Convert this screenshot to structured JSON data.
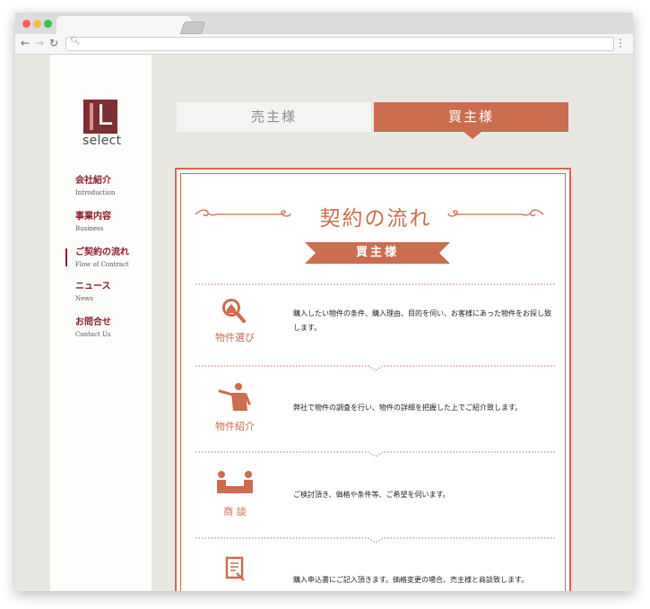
{
  "sidebar": {
    "logo": {
      "letter": "L",
      "wordmark": "select"
    },
    "items": [
      {
        "jp": "会社紹介",
        "en": "Introduction"
      },
      {
        "jp": "事業内容",
        "en": "Business"
      },
      {
        "jp": "ご契約の流れ",
        "en": "Flow of Contract"
      },
      {
        "jp": "ニュース",
        "en": "News"
      },
      {
        "jp": "お問合せ",
        "en": "Contact Us"
      }
    ]
  },
  "tabs": {
    "seller": "売主様",
    "buyer": "買主様"
  },
  "section": {
    "title": "契約の流れ",
    "ribbon": "買主様",
    "steps": [
      {
        "label": "物件選び",
        "desc": "購入したい物件の条件、購入理由、目的を伺い、お客様にあった物件をお探し致します。"
      },
      {
        "label": "物件紹介",
        "desc": "弊社で物件の調査を行い、物件の詳細を把握した上でご紹介致します。"
      },
      {
        "label": "商 談",
        "desc": "ご検討頂き、価格や条件等、ご希望を伺います。"
      },
      {
        "label": "",
        "desc": "購入申込書にご記入頂きます。価格変更の場合、売主様と商談致します。"
      }
    ]
  },
  "colors": {
    "accent": "#cb6d4f",
    "brand": "#7e2f33",
    "nav_text": "#8a1f2c"
  }
}
